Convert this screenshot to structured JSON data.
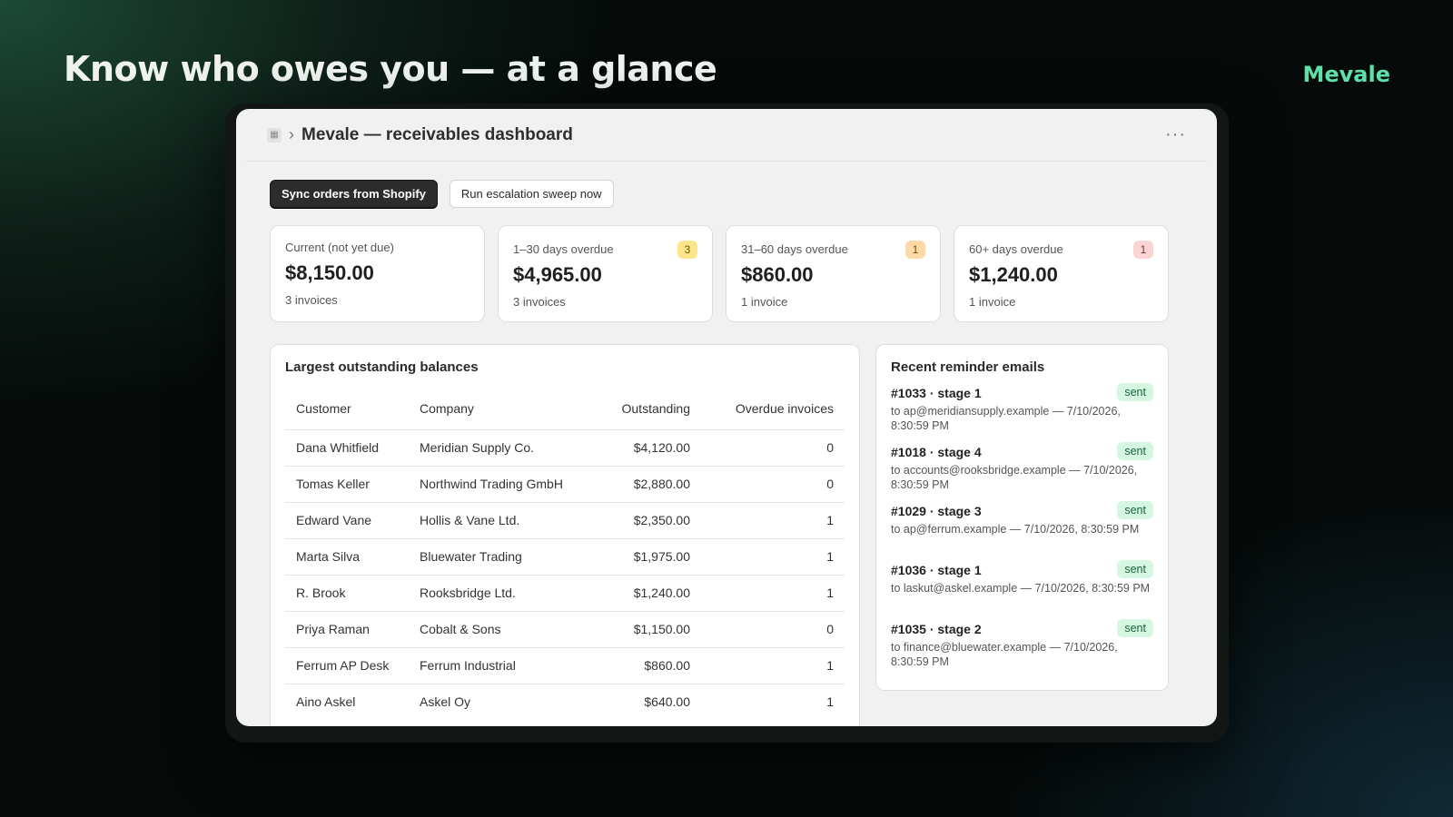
{
  "hero": {
    "headline": "Know who owes you — at a glance",
    "brand": "Mevale"
  },
  "window": {
    "title": "Mevale — receivables dashboard",
    "breadcrumb_sep": "›",
    "more": "···"
  },
  "actions": {
    "sync_label": "Sync orders from Shopify",
    "sweep_label": "Run escalation sweep now"
  },
  "aging": [
    {
      "label": "Current (not yet due)",
      "amount": "$8,150.00",
      "sub": "3 invoices",
      "badge": "",
      "badge_bg": "",
      "badge_fg": ""
    },
    {
      "label": "1–30 days overdue",
      "amount": "$4,965.00",
      "sub": "3 invoices",
      "badge": "3",
      "badge_bg": "#fde58a",
      "badge_fg": "#6b5200"
    },
    {
      "label": "31–60 days overdue",
      "amount": "$860.00",
      "sub": "1 invoice",
      "badge": "1",
      "badge_bg": "#fcd9a6",
      "badge_fg": "#7a4a00"
    },
    {
      "label": "60+ days overdue",
      "amount": "$1,240.00",
      "sub": "1 invoice",
      "badge": "1",
      "badge_bg": "#fbd4d4",
      "badge_fg": "#8a2a2a"
    }
  ],
  "balances": {
    "title": "Largest outstanding balances",
    "columns": [
      "Customer",
      "Company",
      "Outstanding",
      "Overdue invoices"
    ],
    "rows": [
      [
        "Dana Whitfield",
        "Meridian Supply Co.",
        "$4,120.00",
        "0"
      ],
      [
        "Tomas Keller",
        "Northwind Trading GmbH",
        "$2,880.00",
        "0"
      ],
      [
        "Edward Vane",
        "Hollis & Vane Ltd.",
        "$2,350.00",
        "1"
      ],
      [
        "Marta Silva",
        "Bluewater Trading",
        "$1,975.00",
        "1"
      ],
      [
        "R. Brook",
        "Rooksbridge Ltd.",
        "$1,240.00",
        "1"
      ],
      [
        "Priya Raman",
        "Cobalt & Sons",
        "$1,150.00",
        "0"
      ],
      [
        "Ferrum AP Desk",
        "Ferrum Industrial",
        "$860.00",
        "1"
      ],
      [
        "Aino Askel",
        "Askel Oy",
        "$640.00",
        "1"
      ]
    ]
  },
  "reminders": {
    "title": "Recent reminder emails",
    "items": [
      {
        "head": "#1033 · stage 1",
        "body": "to ap@meridiansupply.example — 7/10/2026, 8:30:59 PM",
        "status": "sent"
      },
      {
        "head": "#1018 · stage 4",
        "body": "to accounts@rooksbridge.example — 7/10/2026, 8:30:59 PM",
        "status": "sent"
      },
      {
        "head": "#1029 · stage 3",
        "body": "to ap@ferrum.example — 7/10/2026, 8:30:59 PM",
        "status": "sent"
      },
      {
        "head": "#1036 · stage 1",
        "body": "to laskut@askel.example — 7/10/2026, 8:30:59 PM",
        "status": "sent"
      },
      {
        "head": "#1035 · stage 2",
        "body": "to finance@bluewater.example — 7/10/2026, 8:30:59 PM",
        "status": "sent"
      }
    ]
  }
}
